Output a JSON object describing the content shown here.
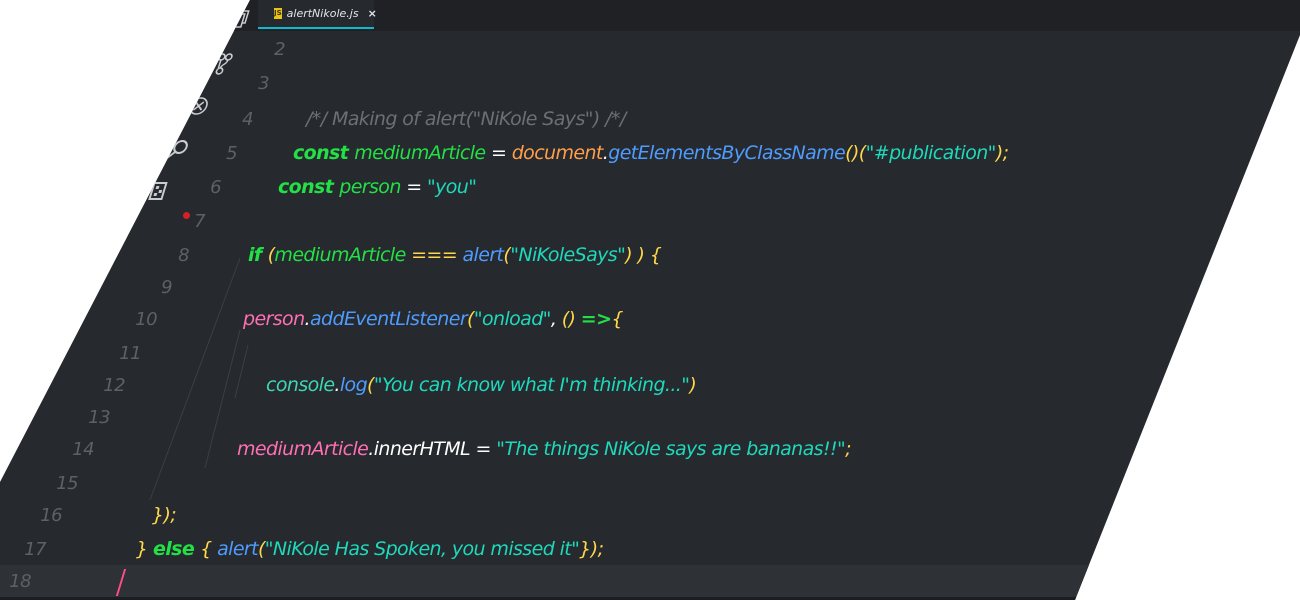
{
  "tab": {
    "icon_text": "JS",
    "filename": "alertNikole.js",
    "close_glyph": "×"
  },
  "activity_bar": [
    "explorer-icon",
    "source-control-icon",
    "extensions-icon",
    "search-icon",
    "debug-icon"
  ],
  "lines": [
    {
      "n": "2",
      "tokens": []
    },
    {
      "n": "3",
      "tokens": []
    },
    {
      "n": "4",
      "tokens": [
        {
          "t": "/*/",
          "c": "cmt"
        },
        {
          "t": "        Making of alert(\"NiKole Says\")        ",
          "c": "cmt"
        },
        {
          "t": "/*/",
          "c": "cmt"
        }
      ]
    },
    {
      "n": "5",
      "tokens": [
        {
          "t": "const ",
          "c": "kw"
        },
        {
          "t": "mediumArticle",
          "c": "var"
        },
        {
          "t": " = ",
          "c": "op"
        },
        {
          "t": "document",
          "c": "doc"
        },
        {
          "t": ".",
          "c": "op"
        },
        {
          "t": "getElementsByClassName",
          "c": "meth"
        },
        {
          "t": "(",
          "c": "yel"
        },
        {
          "t": ")",
          "c": "yel"
        },
        {
          "t": "(",
          "c": "yel"
        },
        {
          "t": "\"#publication\"",
          "c": "str"
        },
        {
          "t": ");",
          "c": "yel"
        }
      ]
    },
    {
      "n": "6",
      "tokens": [
        {
          "t": "const ",
          "c": "kw"
        },
        {
          "t": "person",
          "c": "var"
        },
        {
          "t": " = ",
          "c": "op"
        },
        {
          "t": "\"you\"",
          "c": "str"
        }
      ]
    },
    {
      "n": "7",
      "tokens": []
    },
    {
      "n": "8",
      "tokens": [
        {
          "t": "if ",
          "c": "kw"
        },
        {
          "t": "(",
          "c": "yel"
        },
        {
          "t": "mediumArticle",
          "c": "var"
        },
        {
          "t": " === ",
          "c": "yel"
        },
        {
          "t": "alert",
          "c": "meth"
        },
        {
          "t": "(",
          "c": "yel"
        },
        {
          "t": "\"NiKoleSays\"",
          "c": "str"
        },
        {
          "t": ") )  {",
          "c": "yel"
        }
      ]
    },
    {
      "n": "9",
      "tokens": []
    },
    {
      "n": "10",
      "tokens": [
        {
          "t": "person",
          "c": "pink"
        },
        {
          "t": ".",
          "c": "op"
        },
        {
          "t": "addEventListener",
          "c": "meth"
        },
        {
          "t": "(",
          "c": "yel"
        },
        {
          "t": "\"onload\"",
          "c": "str"
        },
        {
          "t": ", ",
          "c": "op"
        },
        {
          "t": "() ",
          "c": "yel"
        },
        {
          "t": "=>",
          "c": "arrow"
        },
        {
          "t": "{",
          "c": "yel"
        }
      ]
    },
    {
      "n": "11",
      "tokens": []
    },
    {
      "n": "12",
      "tokens": [
        {
          "t": "console",
          "c": "teal"
        },
        {
          "t": ".",
          "c": "op"
        },
        {
          "t": "log",
          "c": "meth"
        },
        {
          "t": "(",
          "c": "yel"
        },
        {
          "t": "\"You can know what I'm thinking...\"",
          "c": "str"
        },
        {
          "t": ")",
          "c": "yel"
        }
      ]
    },
    {
      "n": "13",
      "tokens": []
    },
    {
      "n": "14",
      "tokens": [
        {
          "t": "mediumArticle",
          "c": "pink"
        },
        {
          "t": ".",
          "c": "op"
        },
        {
          "t": "innerHTML",
          "c": "white"
        },
        {
          "t": " = ",
          "c": "op"
        },
        {
          "t": "\"The things NiKole says are bananas!!\"",
          "c": "str"
        },
        {
          "t": ";",
          "c": "yel"
        }
      ]
    },
    {
      "n": "15",
      "tokens": []
    },
    {
      "n": "16",
      "tokens": [
        {
          "t": "});",
          "c": "yel"
        }
      ]
    },
    {
      "n": "17",
      "tokens": [
        {
          "t": "} ",
          "c": "yel"
        },
        {
          "t": "else ",
          "c": "kw"
        },
        {
          "t": "{ ",
          "c": "yel"
        },
        {
          "t": "alert",
          "c": "meth"
        },
        {
          "t": "(",
          "c": "yel"
        },
        {
          "t": "\"NiKole Has Spoken, you missed it\"",
          "c": "str"
        },
        {
          "t": "});",
          "c": "yel"
        }
      ]
    },
    {
      "n": "18",
      "tokens": []
    }
  ],
  "colors": {
    "editor_bg": "#26292d",
    "tab_accent": "#0fb9cf",
    "keyword": "#22e046",
    "string": "#1ed9bc",
    "method": "#4f9cff",
    "breakpoint": "#d5202a",
    "cursor": "#ff4d87"
  }
}
